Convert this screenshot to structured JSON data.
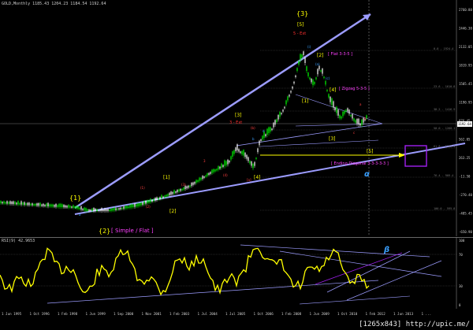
{
  "window": {
    "info_line": "GOLD,Monthly  1185.43 1204.23 1184.54 1192.64",
    "rsi_title": "RSI(9) 42.9653",
    "watermark": "[1265x843] http://upic.me/"
  },
  "current_price": "1192.64",
  "price_axis": [
    "2760.80",
    "2446.30",
    "2132.05",
    "1819.95",
    "1505.45",
    "1190.95",
    "876.45",
    "562.05",
    "263.25",
    "-11.50",
    "-270.40",
    "-485.45",
    "-650.90"
  ],
  "rsi_axis": [
    "100",
    "70",
    "30",
    "0"
  ],
  "time_axis": [
    "1 Jun 1995",
    "1 Oct 1996",
    "1 Feb 1998",
    "1 Jun 1999",
    "1 Sep 2000",
    "1 Nov 2001",
    "1 Feb 2003",
    "1 Jul 2004",
    "1 Jul 2005",
    "1 Oct 2006",
    "1 Feb 2008",
    "1 Jun 2009",
    "1 Oct 2010",
    "1 Feb 2012",
    "1 Jun 2013",
    "1 ..."
  ],
  "wave_labels": {
    "w3_top": "{3}",
    "w5_top": "[5]",
    "w5_red": "5 - Ext",
    "w1_major": "{1}",
    "w2_major": "{2}",
    "simple_flat": "[ Simple / Flat ]",
    "b1": "[1]",
    "b2": "[2]",
    "b3": "[3]",
    "b4": "[4]",
    "c1": "[1]",
    "c2": "[2]",
    "c3": "[3]",
    "c4": "[4]",
    "c5": "[5]",
    "flat": "[ Flat 3-3-5 ]",
    "zigzag": "[ Zigzag 5-3-5 ]",
    "ending": "[ Ending Diagonal 3-3-3-3-3 ]",
    "ext3": "3 - Ext",
    "alpha": "α",
    "beta": "β"
  },
  "fib_labels": [
    "0.0 - 1924.4",
    "23.6 - 1610.8",
    "38.2 - 1416.9",
    "50.0 - 1260.1",
    "61.8 - 1103.3",
    "76.4 - 909.4",
    "100.0 - 595.8"
  ],
  "colors": {
    "bg": "#000000",
    "candle_up": "#00ff00",
    "candle_down": "#ffffff",
    "rsi": "#ffff00",
    "trend": "#9999ff"
  }
}
